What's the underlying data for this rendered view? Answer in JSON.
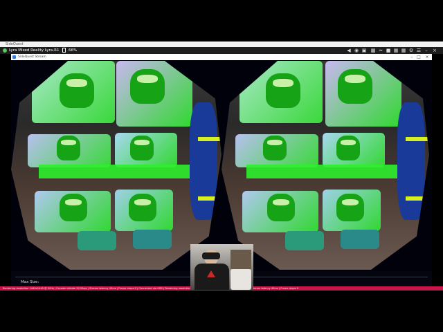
{
  "outer_window": {
    "title": "SideQuest"
  },
  "app_bar": {
    "device_label": "Lyra Mixed Reality Lyra-R1",
    "battery": "66%",
    "status_color": "#5cc85c",
    "icons": [
      "back-icon",
      "browser-icon",
      "monitor-icon",
      "screenshot-icon",
      "wifi-icon",
      "folder-icon",
      "apps-icon",
      "grid-icon",
      "settings-icon",
      "menu-icon",
      "minimize-icon",
      "close-icon"
    ]
  },
  "stream_window": {
    "title": "SideQuest Stream",
    "buttons": [
      "minimize",
      "maximize",
      "close"
    ]
  },
  "settings": {
    "max_size_label": "Max Size:"
  },
  "ticker": {
    "text": "Rendering resolution 1440x1440 @ 90Hz  |  Encoder bitrate 20 Mbps  |  Stream latency 42ms  |  Frame drops 0  |  Connected via USB  |  Rendering resolution 1440x1440 @ 90Hz  |  Encoder bitrate 20 Mbps  |  Stream latency 42ms  |  Frame drops 0"
  },
  "colors": {
    "accent_green": "#2ef02e",
    "ticker_bg": "#c8164a"
  }
}
